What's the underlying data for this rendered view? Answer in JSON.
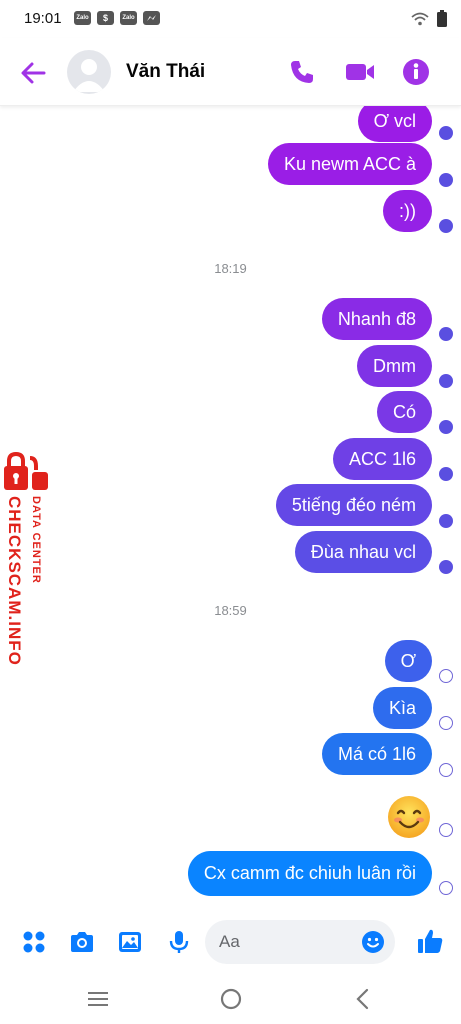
{
  "status_bar": {
    "time": "19:01",
    "apps": [
      "Zalo",
      "$",
      "Zalo",
      ""
    ]
  },
  "header": {
    "contact_name": "Văn Thái"
  },
  "messages": [
    {
      "text": "Ơ vcl",
      "color": "#9b1ce6",
      "receipt": "seen"
    },
    {
      "text": "Ku newm ACC à",
      "color": "#9a1ee6",
      "receipt": "seen"
    },
    {
      "text": ":))",
      "color": "#9521e6",
      "receipt": "seen"
    },
    {
      "type": "timestamp",
      "text": "18:19"
    },
    {
      "text": "Nhanh đ8",
      "color": "#8a2be6",
      "receipt": "seen"
    },
    {
      "text": "Dmm",
      "color": "#7f33e6",
      "receipt": "seen"
    },
    {
      "text": "Có",
      "color": "#7a38e6",
      "receipt": "seen"
    },
    {
      "text": "ACC 1l6",
      "color": "#6f40e6",
      "receipt": "seen"
    },
    {
      "text": "5tiếng đéo ném",
      "color": "#6448e6",
      "receipt": "seen"
    },
    {
      "text": "Đùa nhau vcl",
      "color": "#5b4ee6",
      "receipt": "seen"
    },
    {
      "type": "timestamp",
      "text": "18:59"
    },
    {
      "text": "Ơ",
      "color": "#3d61ec",
      "receipt": "sent"
    },
    {
      "text": "Kìa",
      "color": "#2e6cee",
      "receipt": "sent"
    },
    {
      "text": "Má có 1l6",
      "color": "#2374f0",
      "receipt": "sent"
    },
    {
      "type": "emoji",
      "icon": "smiling-face-emoji",
      "receipt": "sent"
    },
    {
      "text": "Cx camm đc chiuh luân rồi",
      "color": "#0a84ff",
      "receipt": "sent"
    }
  ],
  "watermark": {
    "line1": "DATA CENTER",
    "line2": "CHECKSCAM.INFO"
  },
  "composer": {
    "placeholder": "Aa"
  },
  "colors": {
    "accent": "#a033e6",
    "blue": "#0a7cff"
  }
}
